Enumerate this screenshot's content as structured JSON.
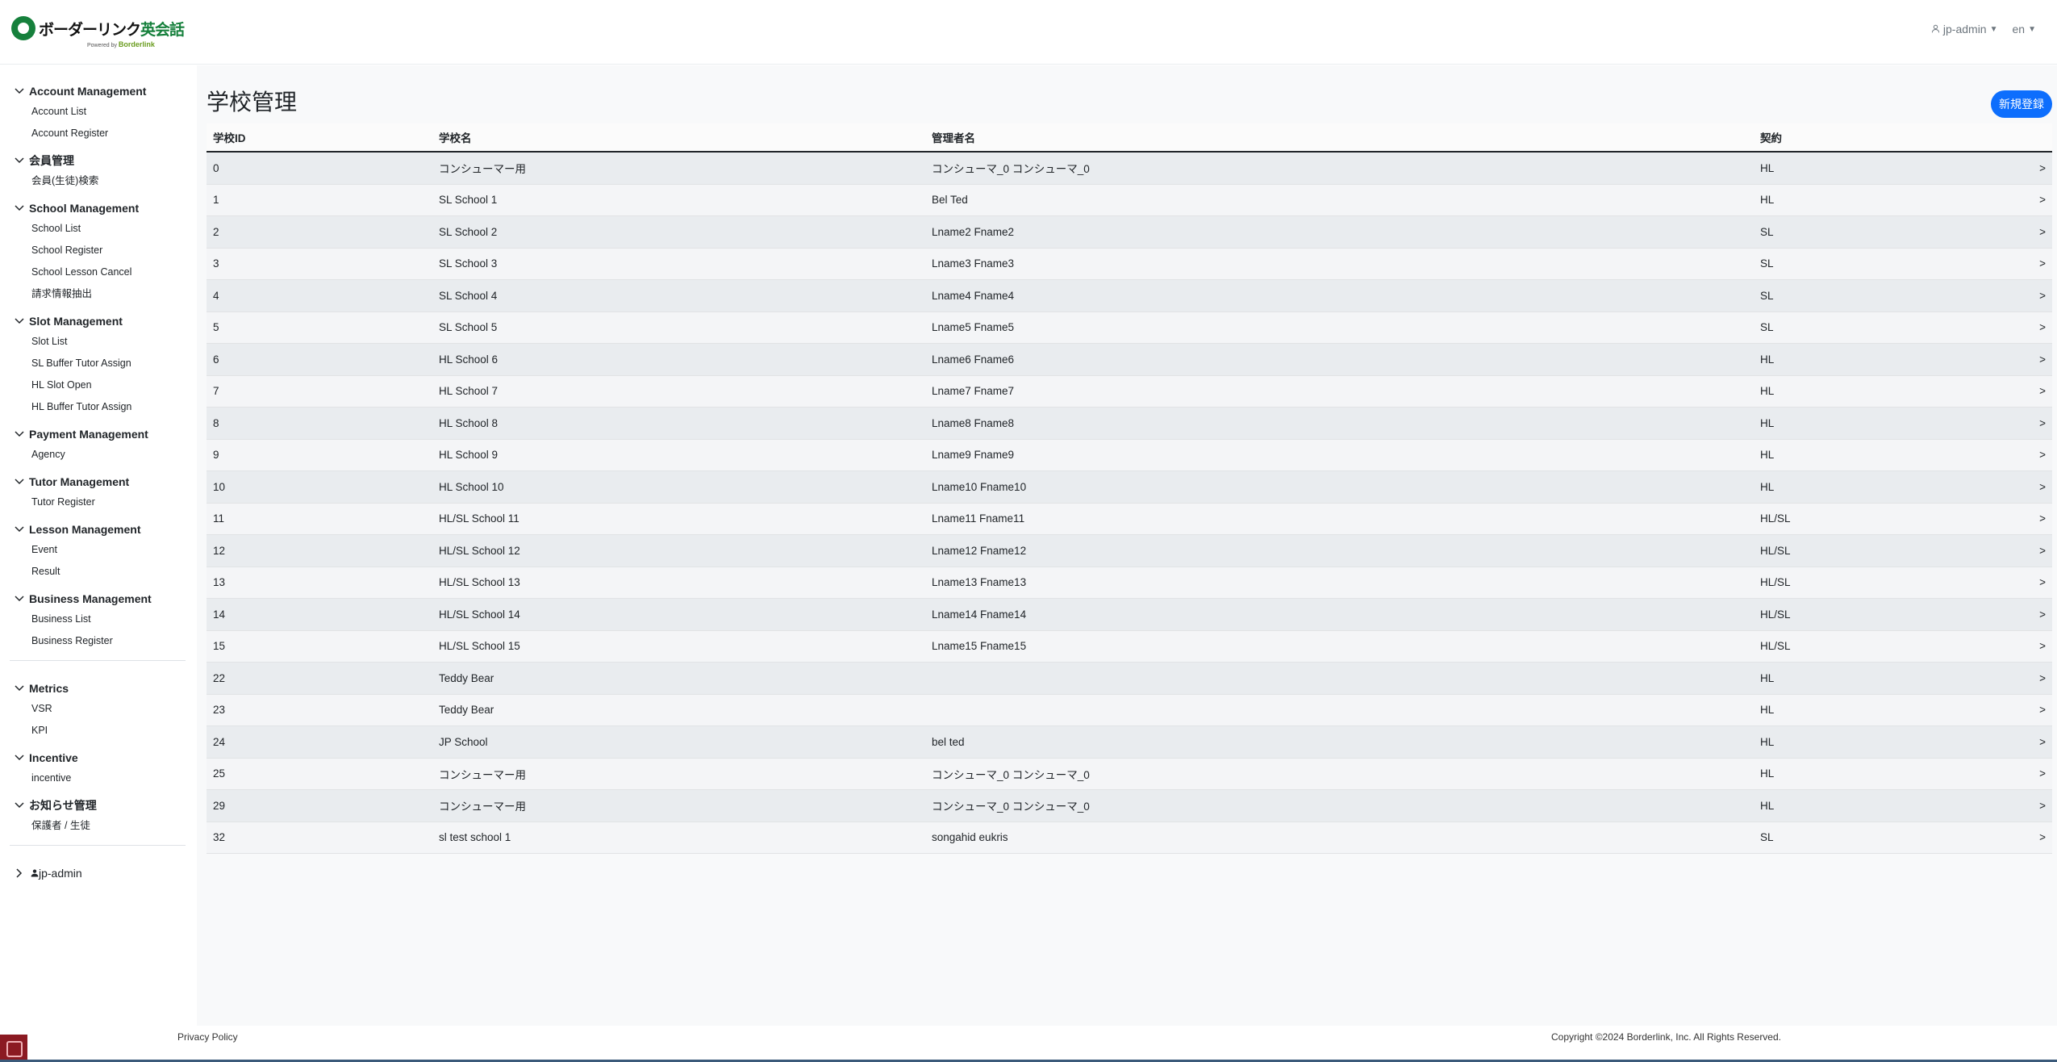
{
  "header": {
    "logo_text": "ボーダーリンク",
    "logo_text_accent": "英会話",
    "logo_sub": "Powered by",
    "logo_sub_brand": "Borderlink",
    "user": "jp-admin",
    "lang": "en"
  },
  "sidebar": {
    "sections": [
      {
        "title": "Account Management",
        "items": [
          "Account List",
          "Account Register"
        ]
      },
      {
        "title": "会員管理",
        "items": [
          "会員(生徒)検索"
        ]
      },
      {
        "title": "School Management",
        "items": [
          "School List",
          "School Register",
          "School Lesson Cancel",
          "請求情報抽出"
        ]
      },
      {
        "title": "Slot Management",
        "items": [
          "Slot List",
          "SL Buffer Tutor Assign",
          "HL Slot Open",
          "HL Buffer Tutor Assign"
        ]
      },
      {
        "title": "Payment Management",
        "items": [
          "Agency"
        ]
      },
      {
        "title": "Tutor Management",
        "items": [
          "Tutor Register"
        ]
      },
      {
        "title": "Lesson Management",
        "items": [
          "Event",
          "Result"
        ]
      },
      {
        "title": "Business Management",
        "items": [
          "Business List",
          "Business Register"
        ]
      },
      {
        "title": "Metrics",
        "items": [
          "VSR",
          "KPI"
        ]
      },
      {
        "title": "Incentive",
        "items": [
          "incentive"
        ]
      },
      {
        "title": "お知らせ管理",
        "items": [
          "保護者 / 生徒"
        ]
      }
    ],
    "user": "jp-admin"
  },
  "main": {
    "title": "学校管理",
    "new_button": "新規登録",
    "columns": [
      "学校ID",
      "学校名",
      "管理者名",
      "契約"
    ],
    "row_arrow": ">",
    "rows": [
      [
        "0",
        "コンシューマー用",
        "コンシューマ_0 コンシューマ_0",
        "HL"
      ],
      [
        "1",
        "SL School 1",
        "Bel Ted",
        "HL"
      ],
      [
        "2",
        "SL School 2",
        "Lname2 Fname2",
        "SL"
      ],
      [
        "3",
        "SL School 3",
        "Lname3 Fname3",
        "SL"
      ],
      [
        "4",
        "SL School 4",
        "Lname4 Fname4",
        "SL"
      ],
      [
        "5",
        "SL School 5",
        "Lname5 Fname5",
        "SL"
      ],
      [
        "6",
        "HL School 6",
        "Lname6 Fname6",
        "HL"
      ],
      [
        "7",
        "HL School 7",
        "Lname7 Fname7",
        "HL"
      ],
      [
        "8",
        "HL School 8",
        "Lname8 Fname8",
        "HL"
      ],
      [
        "9",
        "HL School 9",
        "Lname9 Fname9",
        "HL"
      ],
      [
        "10",
        "HL School 10",
        "Lname10 Fname10",
        "HL"
      ],
      [
        "11",
        "HL/SL School 11",
        "Lname11 Fname11",
        "HL/SL"
      ],
      [
        "12",
        "HL/SL School 12",
        "Lname12 Fname12",
        "HL/SL"
      ],
      [
        "13",
        "HL/SL School 13",
        "Lname13 Fname13",
        "HL/SL"
      ],
      [
        "14",
        "HL/SL School 14",
        "Lname14 Fname14",
        "HL/SL"
      ],
      [
        "15",
        "HL/SL School 15",
        "Lname15 Fname15",
        "HL/SL"
      ],
      [
        "22",
        "Teddy Bear",
        "",
        "HL"
      ],
      [
        "23",
        "Teddy Bear",
        "",
        "HL"
      ],
      [
        "24",
        "JP School",
        "bel ted",
        "HL"
      ],
      [
        "25",
        "コンシューマー用",
        "コンシューマ_0 コンシューマ_0",
        "HL"
      ],
      [
        "29",
        "コンシューマー用",
        "コンシューマ_0 コンシューマ_0",
        "HL"
      ],
      [
        "32",
        "sl test school 1",
        "songahid eukris",
        "SL"
      ]
    ]
  },
  "footer": {
    "privacy": "Privacy Policy",
    "copyright": "Copyright ©2024 Borderlink, Inc. All Rights Reserved."
  },
  "colors": {
    "accent": "#0d6efd",
    "logo_green": "#16803c",
    "row_stripe": "#e9ecef"
  }
}
